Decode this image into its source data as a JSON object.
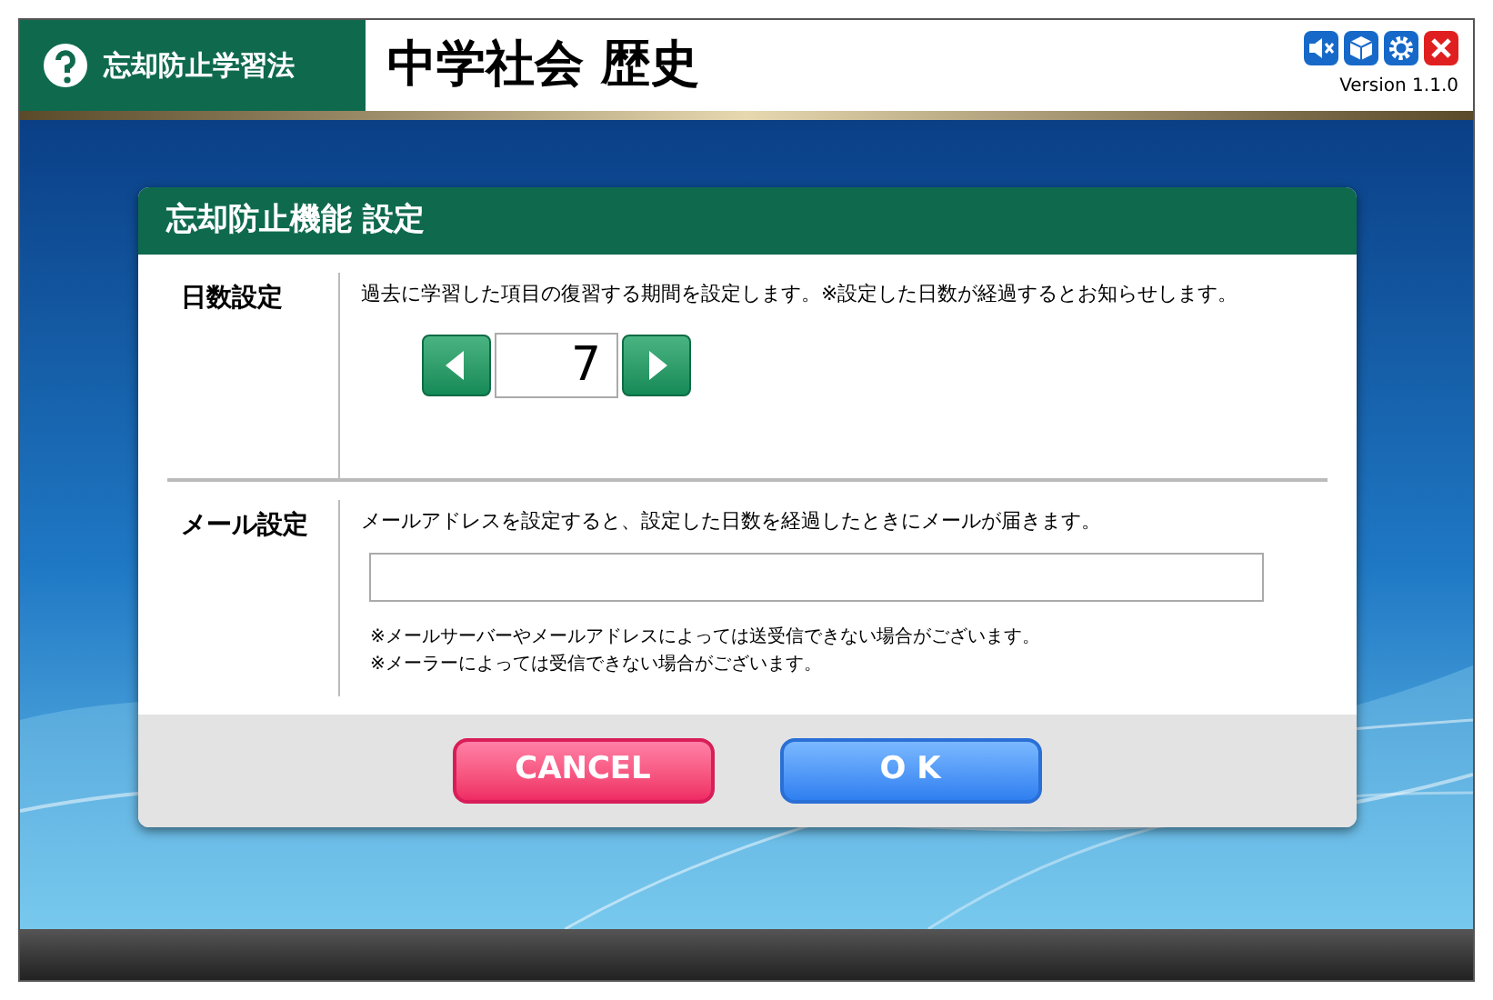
{
  "header": {
    "app_name": "忘却防止学習法",
    "title": "中学社会 歴史",
    "version": "Version 1.1.0"
  },
  "dialog": {
    "title": "忘却防止機能 設定",
    "days": {
      "label": "日数設定",
      "description": "過去に学習した項目の復習する期間を設定します。※設定した日数が経過するとお知らせします。",
      "value": "7"
    },
    "mail": {
      "label": "メール設定",
      "description": "メールアドレスを設定すると、設定した日数を経過したときにメールが届きます。",
      "notes": [
        "※メールサーバーやメールアドレスによっては送受信できない場合がございます。",
        "※メーラーによっては受信できない場合がございます。"
      ]
    },
    "buttons": [
      {
        "label": "CANCEL",
        "kind": "cancel"
      },
      {
        "label": "O K",
        "kind": "ok"
      }
    ]
  }
}
